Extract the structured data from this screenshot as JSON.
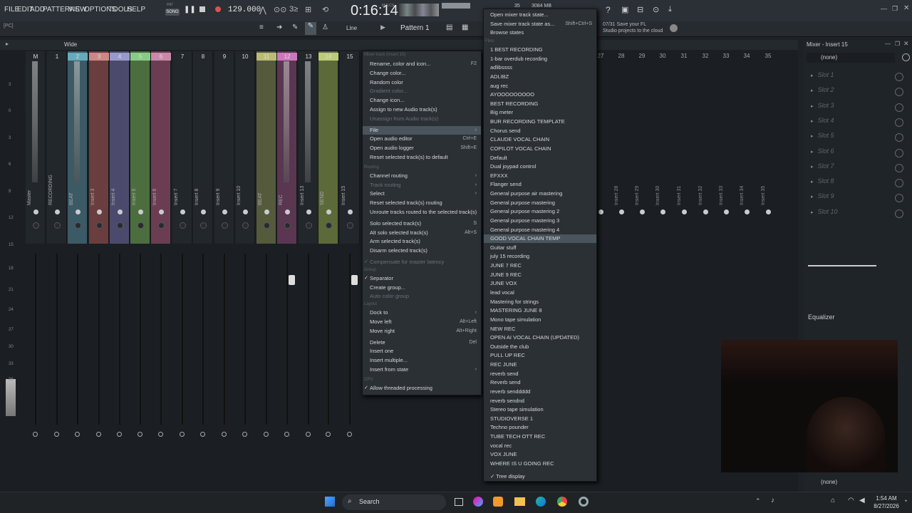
{
  "menubar": [
    "FILE",
    "EDIT",
    "ADD",
    "PATTERNS",
    "VIEW",
    "OPTIONS",
    "TOOLS",
    "HELP"
  ],
  "transport": {
    "song_label": "SONG",
    "pat_label": "PAT",
    "tempo": "129.000",
    "time": "0:16:14",
    "time_unit": "M:S:CS",
    "cpu": "35",
    "ram": "3084 MB"
  },
  "toolbar2": {
    "line_label": "Line",
    "pattern_label": "Pattern 1",
    "wide_label": "Wide",
    "pc_label": "[PC]"
  },
  "hint": {
    "line1": "07/31  Save your FL",
    "line2": "Studio projects to the cloud"
  },
  "mixer": {
    "track_numbers": [
      "M",
      "1",
      "2",
      "3",
      "4",
      "5",
      "6",
      "7",
      "8",
      "9",
      "10",
      "11",
      "12",
      "13",
      "14",
      "15"
    ],
    "right_numbers": [
      "27",
      "28",
      "29",
      "30",
      "31",
      "32",
      "33",
      "34",
      "35"
    ],
    "labels": [
      "Master",
      "RECORDING",
      "BEAT",
      "Insert 3",
      "Insert 4",
      "Insert 5",
      "Insert 6",
      "Insert 7",
      "Insert 8",
      "Insert 9",
      "Insert 10",
      "BEAT",
      "REC",
      "Insert 13",
      "SEND",
      "Insert 15"
    ],
    "right_labels": [
      "Insert 28",
      "Insert 29",
      "Insert 30",
      "Insert 31",
      "Insert 32",
      "Insert 33",
      "Insert 34",
      "Insert 35"
    ],
    "db_scale": [
      "3",
      "0",
      "3",
      "6",
      "9",
      "12",
      "15",
      "18",
      "21",
      "24",
      "27",
      "30",
      "33",
      "36"
    ]
  },
  "context_menu": {
    "title": "Mixer track (Insert 15)",
    "items": [
      {
        "t": "Rename, color and icon...",
        "sc": "F2"
      },
      {
        "t": "Change color..."
      },
      {
        "t": "Random color"
      },
      {
        "t": "Gradient color...",
        "dis": true
      },
      {
        "t": "Change icon..."
      },
      {
        "t": "Assign to new Audio track(s)"
      },
      {
        "t": "Unassign from Audio track(s)",
        "dis": true
      },
      {
        "t": "File",
        "hl": true,
        "sub": true
      },
      {
        "t": "Open audio editor",
        "sc": "Ctrl+E"
      },
      {
        "t": "Open audio logger",
        "sc": "Shift+E"
      },
      {
        "t": "Reset selected track(s) to default"
      },
      {
        "t": "Routing",
        "sec": true
      },
      {
        "t": "Channel routing",
        "sub": true
      },
      {
        "t": "Track routing",
        "dis": true,
        "sub": true
      },
      {
        "t": "Select",
        "sub": true
      },
      {
        "t": "Reset selected track(s) routing"
      },
      {
        "t": "Unroute tracks routed to the selected track(s)"
      },
      {
        "t": "Solo selected track(s)",
        "sc": "S"
      },
      {
        "t": "Alt solo selected track(s)",
        "sc": "Alt+S"
      },
      {
        "t": "Arm selected track(s)"
      },
      {
        "t": "Disarm selected track(s)"
      },
      {
        "t": "Compensate for master latency",
        "dis": true,
        "check": true
      },
      {
        "t": "Group",
        "sec": true
      },
      {
        "t": "Separator",
        "check": true
      },
      {
        "t": "Create group..."
      },
      {
        "t": "Auto color group",
        "dis": true
      },
      {
        "t": "Layout",
        "sec": true
      },
      {
        "t": "Dock to",
        "sub": true
      },
      {
        "t": "Move left",
        "sc": "Alt+Left"
      },
      {
        "t": "Move right",
        "sc": "Alt+Right"
      },
      {
        "t": "Delete",
        "sc": "Del"
      },
      {
        "t": "Insert one"
      },
      {
        "t": "Insert multiple..."
      },
      {
        "t": "Insert from state",
        "sub": true
      },
      {
        "t": "CPU",
        "sec": true
      },
      {
        "t": "Allow threaded processing",
        "check": true
      }
    ]
  },
  "preset_menu": {
    "top_items": [
      {
        "t": "Open mixer track state..."
      },
      {
        "t": "Save mixer track state as...",
        "sc": "Shift+Ctrl+S"
      },
      {
        "t": "Browse states"
      }
    ],
    "section": "Files",
    "items": [
      "1 BEST RECORDING",
      "1-bar overdub recording",
      "adlibssss",
      "ADLIBZ",
      "aug rec",
      "AYOOOOOOOOO",
      "BEST RECORDING",
      "Big meter",
      "BUR RECORDING TEMPLATE",
      "Chorus send",
      "CLAUDE VOCAL CHAIN",
      "COPILOT VOCAL CHAIN",
      "Default",
      "Dual joypad control",
      "EFXXX",
      "Flanger send",
      "General purpose air mastering",
      "General purpose mastering",
      "General purpose mastering 2",
      "General purpose mastering 3",
      "General purpose mastering 4",
      "GOOD VOCAL CHAIN TEMP",
      "Guitar stuff",
      "july 15 recording",
      "JUNE 7 REC",
      "JUNE 9 REC",
      "JUNE VOX",
      "lead vocal",
      "Mastering for strings",
      "MASTERING JUNE 8",
      "Mono tape simulation",
      "NEW REC",
      "OPEN AI VOCAL CHAIN (UPDATED)",
      "Outside the club",
      "PULL UP REC",
      "REC JUNE",
      "reverb send",
      "Reverb send",
      "reverb senddddd",
      "reverb sendnd",
      "Stereo tape simulation",
      "STUDIOVERSE 1",
      "Techno pounder",
      "TUBE TECH OTT REC",
      "vocal rec",
      "VOX JUNE",
      "WHERE IS U GOING REC"
    ],
    "highlighted": "GOOD VOCAL CHAIN TEMP",
    "footer": "Tree display"
  },
  "right_panel": {
    "title": "Mixer - Insert 15",
    "none_label": "(none)",
    "slots": [
      "Slot 1",
      "Slot 2",
      "Slot 3",
      "Slot 4",
      "Slot 5",
      "Slot 6",
      "Slot 7",
      "Slot 8",
      "Slot 9",
      "Slot 10"
    ],
    "equalizer": "Equalizer",
    "bottom_none": "(none)"
  },
  "taskbar": {
    "search": "Search",
    "time": "1:54 AM",
    "date": "8/27/2026"
  }
}
